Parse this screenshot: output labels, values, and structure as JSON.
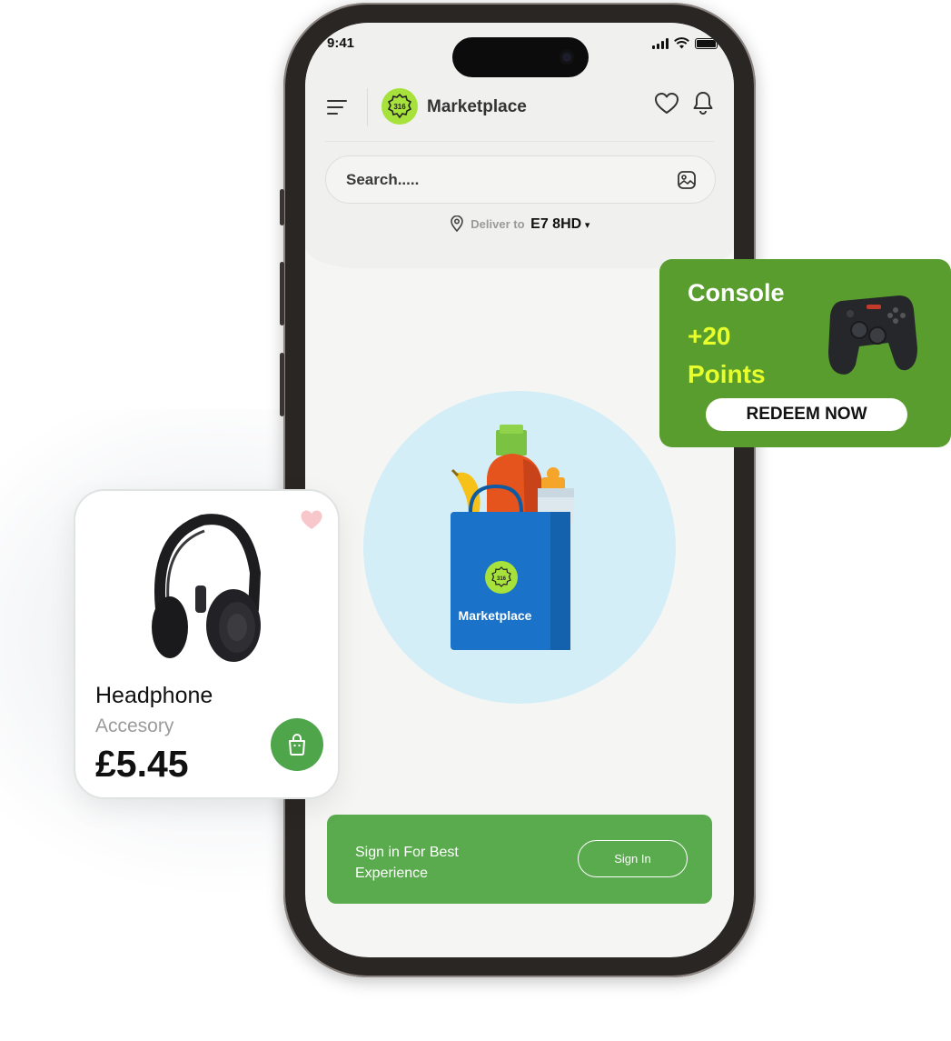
{
  "status_bar": {
    "time": "9:41"
  },
  "header": {
    "brand_name": "Marketplace",
    "logo_number": "316"
  },
  "search": {
    "placeholder": "Search....."
  },
  "delivery": {
    "label": "Deliver to",
    "postcode": "E7 8HD",
    "arrow": "▾"
  },
  "illustration": {
    "bag_label": "Marketplace",
    "bag_logo_number": "316"
  },
  "signin_banner": {
    "message": "Sign in For Best Experience",
    "button_label": "Sign In"
  },
  "promo": {
    "title": "Console",
    "points_line1": "+20",
    "points_line2": "Points",
    "button_label": "REDEEM NOW",
    "accent_color": "#e7ff2b",
    "background_color": "#599d2f"
  },
  "product": {
    "name": "Headphone",
    "category": "Accesory",
    "price": "£5.45"
  },
  "icons": [
    "menu-icon",
    "logo-badge",
    "heart-icon",
    "bell-icon",
    "image-search-icon",
    "location-pin-icon",
    "gamepad-icon",
    "headphone-image",
    "favorite-icon",
    "shopping-bag-icon"
  ]
}
